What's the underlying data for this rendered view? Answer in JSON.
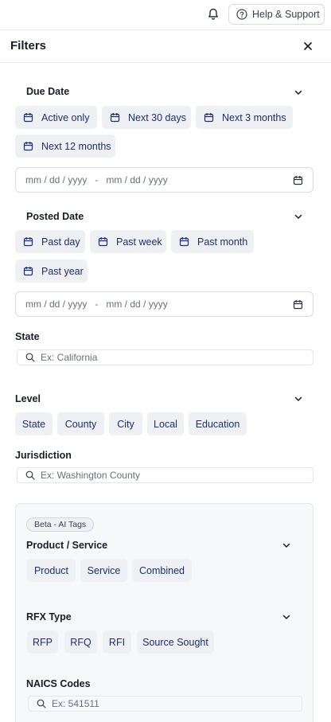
{
  "topbar": {
    "bell_icon": "bell-icon",
    "help_icon": "help-circle-icon",
    "help_label": "Help & Support"
  },
  "panel": {
    "title": "Filters",
    "close_icon": "close-icon"
  },
  "due_date": {
    "label": "Due Date",
    "chips": [
      "Active only",
      "Next 30 days",
      "Next 3 months",
      "Next 12 months"
    ],
    "chip_icon": "calendar-icon",
    "range": {
      "start_placeholder": "mm / dd / yyyy",
      "separator": "-",
      "end_placeholder": "mm / dd / yyyy"
    }
  },
  "posted_date": {
    "label": "Posted Date",
    "chips": [
      "Past day",
      "Past week",
      "Past month",
      "Past year"
    ],
    "chip_icon": "calendar-icon",
    "range": {
      "start_placeholder": "mm / dd / yyyy",
      "separator": "-",
      "end_placeholder": "mm / dd / yyyy"
    }
  },
  "state": {
    "label": "State",
    "placeholder": "Ex: California"
  },
  "level": {
    "label": "Level",
    "chips": [
      "State",
      "County",
      "City",
      "Local",
      "Education"
    ]
  },
  "jurisdiction": {
    "label": "Jurisdiction",
    "placeholder": "Ex: Washington County"
  },
  "ai_tags": {
    "badge": "Beta - AI Tags",
    "product_service": {
      "label": "Product / Service",
      "chips": [
        "Product",
        "Service",
        "Combined"
      ]
    },
    "rfx_type": {
      "label": "RFX Type",
      "chips": [
        "RFP",
        "RFQ",
        "RFI",
        "Source Sought"
      ]
    },
    "naics": {
      "label": "NAICS Codes",
      "placeholder": "Ex: 541511"
    }
  },
  "colors": {
    "chip_bg": "#eef0f4",
    "chip_text": "#1d2f6b",
    "border": "#d9dce3"
  }
}
